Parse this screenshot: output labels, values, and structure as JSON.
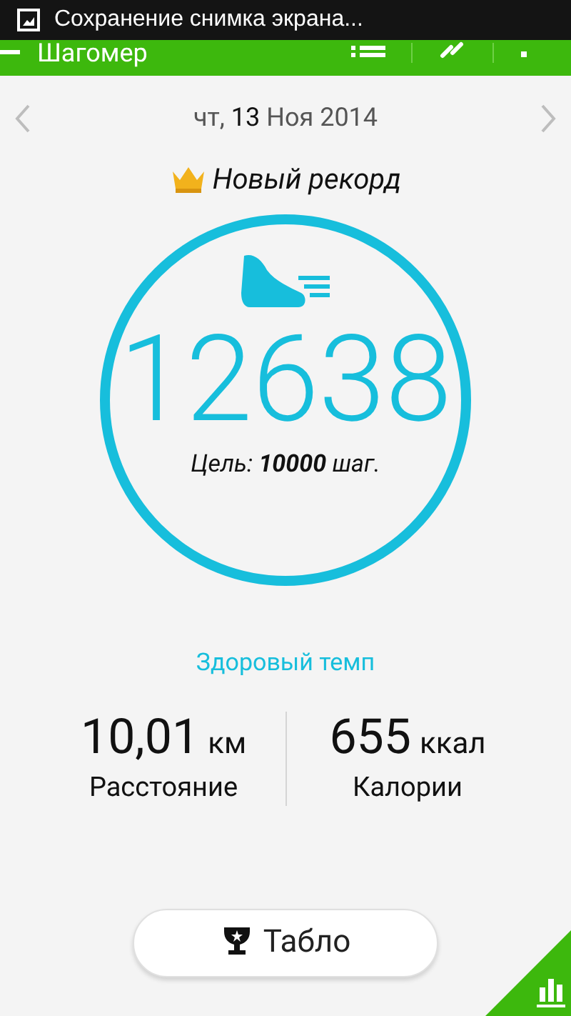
{
  "notification": {
    "text": "Сохранение снимка экрана..."
  },
  "app_bar": {
    "title": "Шагомер"
  },
  "date": {
    "text": "чт, **13** Ноя 2014"
  },
  "record": {
    "text": "Новый рекорд"
  },
  "steps": {
    "count": "12638",
    "goal": "Цель: **10000** шаг."
  },
  "pace": "Здоровый темп",
  "stats": [
    {
      "value": "10,01",
      "unit": "км",
      "label": "Расстояние"
    },
    {
      "value": "655",
      "unit": "ккал",
      "label": "Калории"
    }
  ],
  "button": {
    "label": "Табло"
  }
}
